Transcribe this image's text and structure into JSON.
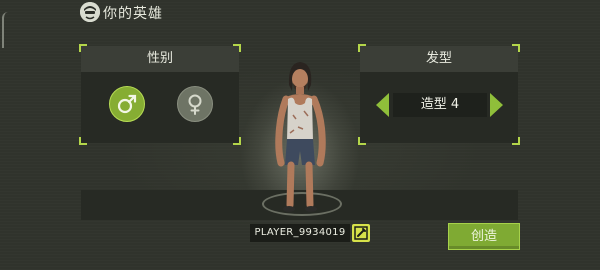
{
  "header": {
    "title": "你的英雄",
    "icon": "hero-face-icon"
  },
  "gender_panel": {
    "title": "性别",
    "male_icon": "male-symbol-icon",
    "female_icon": "female-symbol-icon",
    "selected": "male"
  },
  "hair_panel": {
    "title": "发型",
    "current_style": "造型 4",
    "prev_icon": "arrow-left-icon",
    "next_icon": "arrow-right-icon"
  },
  "player": {
    "name": "PLAYER_9934019",
    "edit_icon": "edit-pencil-icon"
  },
  "create_button": {
    "label": "创造"
  },
  "colors": {
    "accent": "#86ad33",
    "panel": "#272a24",
    "background": "#30332c"
  }
}
